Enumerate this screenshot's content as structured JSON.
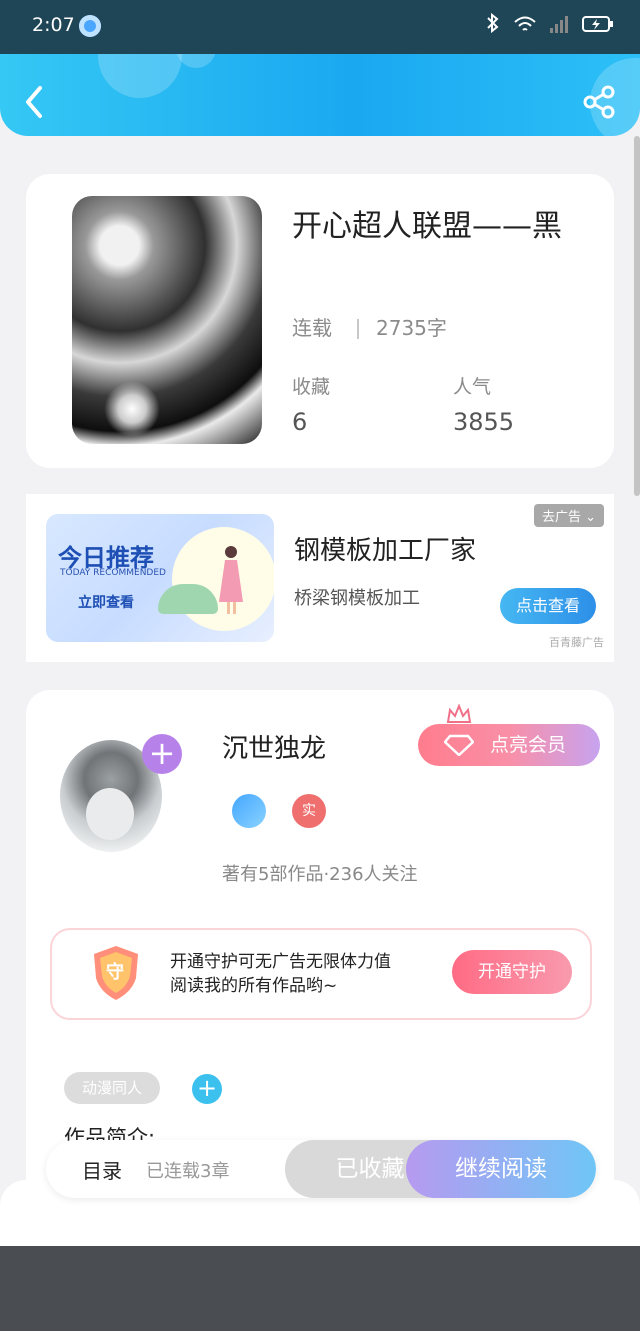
{
  "status_bar": {
    "time": "2:07",
    "icons": [
      "bluetooth-icon",
      "wifi-icon",
      "signal-icon",
      "battery-charging-icon"
    ]
  },
  "header": {
    "icons": [
      "back-icon",
      "share-icon"
    ],
    "accent": "#1aa8f1"
  },
  "book": {
    "title": "开心超人联盟——黑",
    "status": "连载",
    "word_count": "2735字",
    "favorites_label": "收藏",
    "favorites_value": "6",
    "popularity_label": "人气",
    "popularity_value": "3855"
  },
  "ad": {
    "image_title": "今日推荐",
    "image_subtitle": "TODAY RECOMMENDED",
    "image_button": "立即查看",
    "title": "钢模板加工厂家",
    "description": "桥梁钢模板加工",
    "remove_label": "去广告",
    "cta": "点击查看",
    "source": "百青藤广告"
  },
  "author": {
    "name": "沉世独龙",
    "vip_button": "点亮会员",
    "badge_real": "实",
    "stats": "著有5部作品·236人关注"
  },
  "guard": {
    "badge_char": "守",
    "text_line1": "开通守护可无广告无限体力值",
    "text_line2": "阅读我的所有作品哟~",
    "button": "开通守护"
  },
  "tags": {
    "items": [
      "动漫同人"
    ]
  },
  "intro": {
    "heading": "作品简介:"
  },
  "bottom": {
    "toc": "目录",
    "chapters": "已连载3章",
    "collected": "已收藏",
    "continue": "继续阅读"
  }
}
